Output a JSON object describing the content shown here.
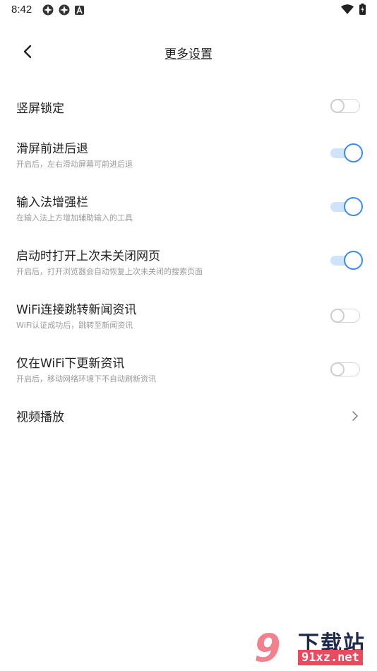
{
  "status_bar": {
    "time": "8:42",
    "left_icons": [
      "app-icon",
      "app-icon",
      "notification-a-icon"
    ],
    "right_icons": [
      "wifi-icon",
      "battery-icon"
    ]
  },
  "header": {
    "back_icon": "back-arrow-icon",
    "title": "更多设置"
  },
  "settings": [
    {
      "label": "竖屏锁定",
      "subtitle": "",
      "control": "toggle",
      "checked": false
    },
    {
      "label": "滑屏前进后退",
      "subtitle": "开启后，左右滑动屏幕可前进后退",
      "control": "toggle",
      "checked": true
    },
    {
      "label": "输入法增强栏",
      "subtitle": "在输入法上方增加辅助输入的工具",
      "control": "toggle",
      "checked": true
    },
    {
      "label": "启动时打开上次未关闭网页",
      "subtitle": "开启后，打开浏览器会自动恢复上次未关闭的搜索页面",
      "control": "toggle",
      "checked": true
    },
    {
      "label": "WiFi连接跳转新闻资讯",
      "subtitle": "WiFi认证成功后，跳转至新闻资讯",
      "control": "toggle",
      "checked": false
    },
    {
      "label": "仅在WiFi下更新资讯",
      "subtitle": "开启后，移动网络环境下不自动刷新资讯",
      "control": "toggle",
      "checked": false
    },
    {
      "label": "视频播放",
      "subtitle": "",
      "control": "chevron"
    }
  ],
  "watermark": {
    "text": "下载站",
    "url": "91xz.net"
  },
  "colors": {
    "accent": "#3b8beb",
    "toggle_track_on": "#cfe3fb",
    "subtitle": "#9a9a9a"
  }
}
